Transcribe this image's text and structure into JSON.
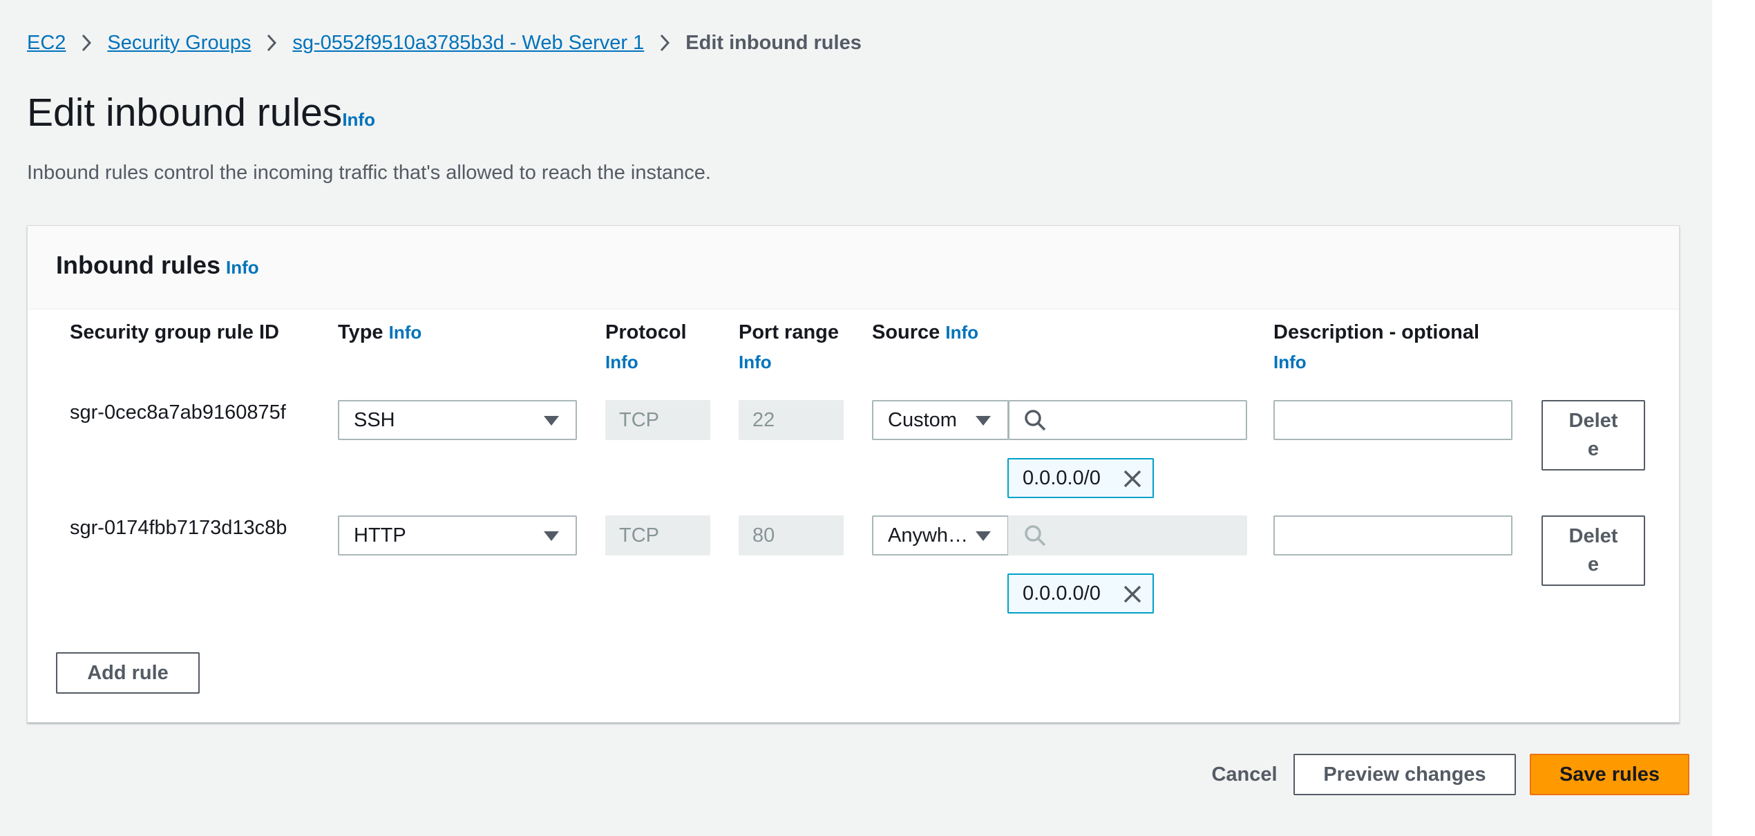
{
  "breadcrumb": {
    "items": [
      "EC2",
      "Security Groups",
      "sg-0552f9510a3785b3d - Web Server 1"
    ],
    "current": "Edit inbound rules"
  },
  "page": {
    "title": "Edit inbound rules",
    "info_label": "Info",
    "description": "Inbound rules control the incoming traffic that's allowed to reach the instance."
  },
  "panel": {
    "title": "Inbound rules",
    "info_label": "Info",
    "columns": {
      "rule_id": "Security group rule ID",
      "type": "Type",
      "protocol": "Protocol",
      "port_range": "Port range",
      "source": "Source",
      "description": "Description - optional"
    },
    "rules": [
      {
        "rule_id": "sgr-0cec8a7ab9160875f",
        "type": "SSH",
        "protocol": "TCP",
        "port": "22",
        "source_type": "Custom",
        "search_value": "",
        "cidr": "0.0.0.0/0",
        "description": "",
        "delete_label": "Delete"
      },
      {
        "rule_id": "sgr-0174fbb7173d13c8b",
        "type": "HTTP",
        "protocol": "TCP",
        "port": "80",
        "source_type": "Anywh…",
        "search_value": "",
        "cidr": "0.0.0.0/0",
        "description": "",
        "delete_label": "Delete"
      }
    ],
    "add_rule_label": "Add rule"
  },
  "footer": {
    "cancel_label": "Cancel",
    "preview_label": "Preview changes",
    "save_label": "Save rules"
  },
  "colors": {
    "link": "#0073bb",
    "primary": "#ff9900",
    "token_border": "#00a1c9"
  }
}
